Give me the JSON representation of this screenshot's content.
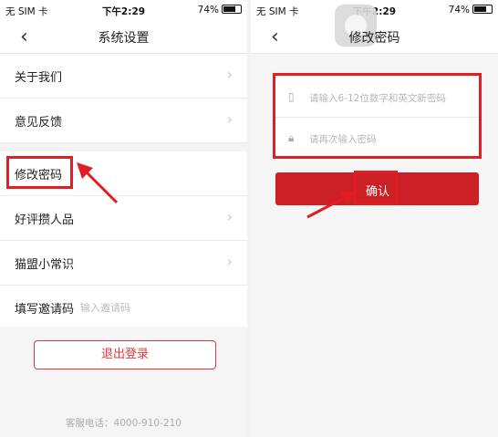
{
  "status_bar": {
    "carrier": "无 SIM 卡",
    "time": "下午2:29",
    "battery": "74%"
  },
  "settings": {
    "nav_title": "系统设置",
    "items": [
      {
        "label": "关于我们"
      },
      {
        "label": "意见反馈"
      },
      {
        "label": "修改密码"
      },
      {
        "label": "好评攒人品"
      },
      {
        "label": "猫盟小常识"
      },
      {
        "label": "填写邀请码"
      }
    ],
    "invite_placeholder": "输入邀请码",
    "logout_label": "退出登录",
    "hotline": "客服电话：4000-910-210"
  },
  "change_password": {
    "nav_title": "修改密码",
    "new_password_placeholder": "请输入6-12位数字和英文新密码",
    "confirm_password_placeholder": "请再次输入密码",
    "confirm_label": "确认"
  },
  "colors": {
    "accent": "#cc1f26",
    "highlight": "#e01e24",
    "background": "#f5f5f5"
  },
  "icons": {
    "back": "chevron-left-icon",
    "chevron": "chevron-right-icon",
    "phone": "phone-icon",
    "lock": "lock-icon"
  }
}
